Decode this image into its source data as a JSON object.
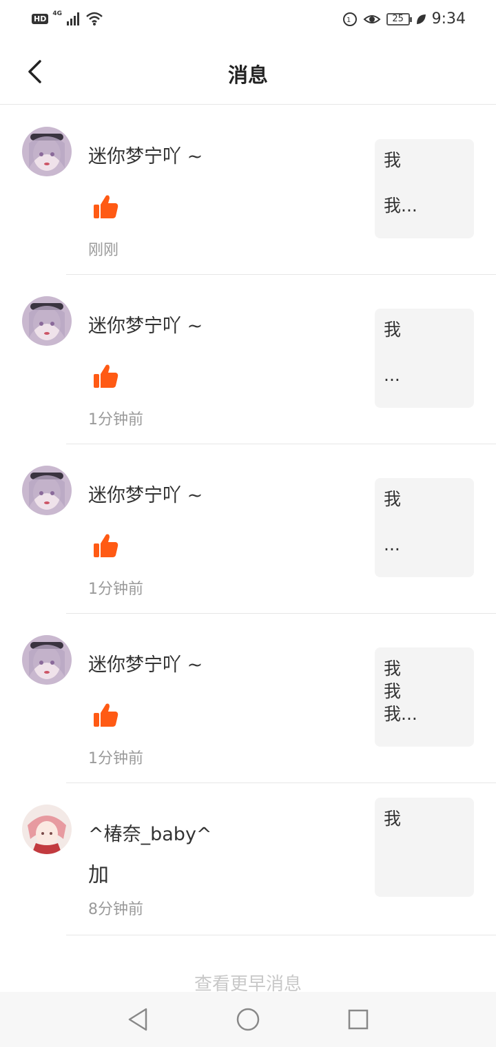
{
  "status_bar": {
    "hd_label": "HD",
    "network_label": "4G",
    "battery_level": "25",
    "time": "9:34"
  },
  "header": {
    "title": "消息"
  },
  "messages": [
    {
      "username": "迷你梦宁吖 ~",
      "type": "like",
      "time": "刚刚",
      "preview": "我\n\n我..."
    },
    {
      "username": "迷你梦宁吖 ~",
      "type": "like",
      "time": "1分钟前",
      "preview": "我\n\n..."
    },
    {
      "username": "迷你梦宁吖 ~",
      "type": "like",
      "time": "1分钟前",
      "preview": "我\n\n..."
    },
    {
      "username": "迷你梦宁吖 ~",
      "type": "like",
      "time": "1分钟前",
      "preview": "我\n我\n我..."
    },
    {
      "username": "^椿奈_baby^",
      "type": "reply",
      "reply_text": "加",
      "time": "8分钟前",
      "preview": "我"
    }
  ],
  "footer": {
    "more_label": "查看更早消息"
  },
  "icons": {
    "like": "thumbs-up-icon",
    "accent_color": "#ff5a14"
  }
}
